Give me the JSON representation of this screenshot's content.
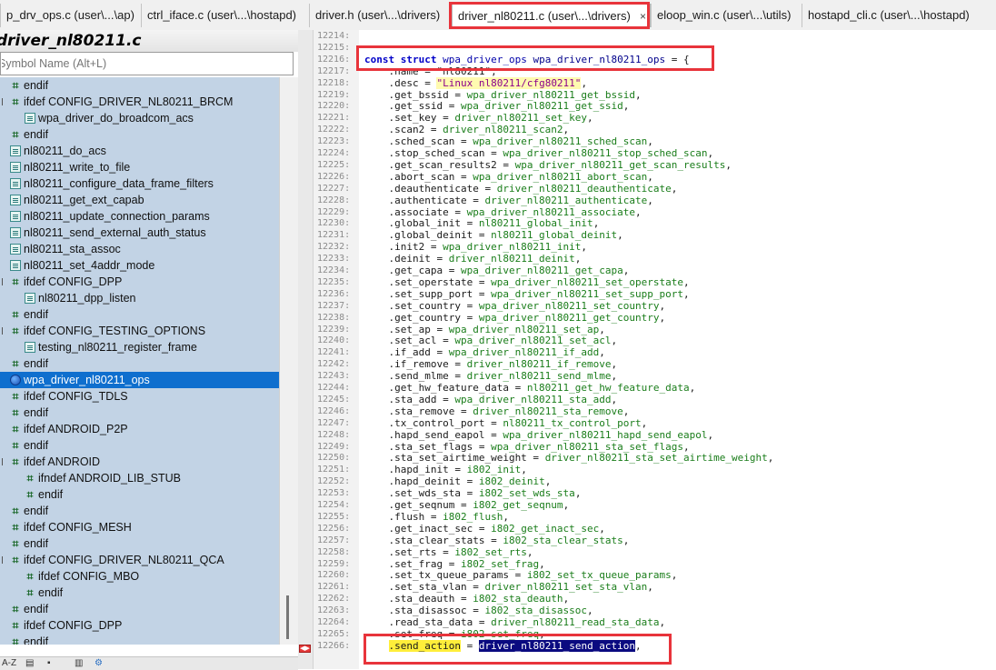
{
  "tabs": [
    {
      "label": "p_drv_ops.c (user\\...\\ap)",
      "active": false
    },
    {
      "label": "ctrl_iface.c (user\\...\\hostapd)",
      "active": false
    },
    {
      "label": "driver.h (user\\...\\drivers)",
      "active": false
    },
    {
      "label": "driver_nl80211.c (user\\...\\drivers)",
      "active": true,
      "close": "×"
    },
    {
      "label": "eloop_win.c (user\\...\\utils)",
      "active": false
    },
    {
      "label": "hostapd_cli.c (user\\...\\hostapd)",
      "active": false
    }
  ],
  "symbol_panel": {
    "file_title": "driver_nl80211.c",
    "search_placeholder": "Symbol Name (Alt+L)",
    "items": [
      {
        "label": "endif",
        "kind": "preproc",
        "indent": 0
      },
      {
        "label": "ifdef CONFIG_DRIVER_NL80211_BRCM",
        "kind": "preproc",
        "indent": 0,
        "collapsible": true
      },
      {
        "label": "wpa_driver_do_broadcom_acs",
        "kind": "function",
        "indent": 1
      },
      {
        "label": "endif",
        "kind": "preproc",
        "indent": 0
      },
      {
        "label": "nl80211_do_acs",
        "kind": "function",
        "indent": 0
      },
      {
        "label": "nl80211_write_to_file",
        "kind": "function",
        "indent": 0
      },
      {
        "label": "nl80211_configure_data_frame_filters",
        "kind": "function",
        "indent": 0
      },
      {
        "label": "nl80211_get_ext_capab",
        "kind": "function",
        "indent": 0
      },
      {
        "label": "nl80211_update_connection_params",
        "kind": "function",
        "indent": 0
      },
      {
        "label": "nl80211_send_external_auth_status",
        "kind": "function",
        "indent": 0
      },
      {
        "label": "nl80211_sta_assoc",
        "kind": "function",
        "indent": 0
      },
      {
        "label": "nl80211_set_4addr_mode",
        "kind": "function",
        "indent": 0
      },
      {
        "label": "ifdef CONFIG_DPP",
        "kind": "preproc",
        "indent": 0,
        "collapsible": true
      },
      {
        "label": "nl80211_dpp_listen",
        "kind": "function",
        "indent": 1
      },
      {
        "label": "endif",
        "kind": "preproc",
        "indent": 0
      },
      {
        "label": "ifdef CONFIG_TESTING_OPTIONS",
        "kind": "preproc",
        "indent": 0,
        "collapsible": true
      },
      {
        "label": "testing_nl80211_register_frame",
        "kind": "function",
        "indent": 1
      },
      {
        "label": "endif",
        "kind": "preproc",
        "indent": 0
      },
      {
        "label": "wpa_driver_nl80211_ops",
        "kind": "variable",
        "indent": 0,
        "selected": true
      },
      {
        "label": "ifdef CONFIG_TDLS",
        "kind": "preproc",
        "indent": 0
      },
      {
        "label": "endif",
        "kind": "preproc",
        "indent": 0
      },
      {
        "label": "ifdef ANDROID_P2P",
        "kind": "preproc",
        "indent": 0
      },
      {
        "label": "endif",
        "kind": "preproc",
        "indent": 0
      },
      {
        "label": "ifdef ANDROID",
        "kind": "preproc",
        "indent": 0,
        "collapsible": true
      },
      {
        "label": "ifndef ANDROID_LIB_STUB",
        "kind": "preproc",
        "indent": 1
      },
      {
        "label": "endif",
        "kind": "preproc",
        "indent": 1
      },
      {
        "label": "endif",
        "kind": "preproc",
        "indent": 0
      },
      {
        "label": "ifdef CONFIG_MESH",
        "kind": "preproc",
        "indent": 0
      },
      {
        "label": "endif",
        "kind": "preproc",
        "indent": 0
      },
      {
        "label": "ifdef CONFIG_DRIVER_NL80211_QCA",
        "kind": "preproc",
        "indent": 0,
        "collapsible": true
      },
      {
        "label": "ifdef CONFIG_MBO",
        "kind": "preproc",
        "indent": 1
      },
      {
        "label": "endif",
        "kind": "preproc",
        "indent": 1
      },
      {
        "label": "endif",
        "kind": "preproc",
        "indent": 0
      },
      {
        "label": "ifdef CONFIG_DPP",
        "kind": "preproc",
        "indent": 0
      },
      {
        "label": "endif",
        "kind": "preproc",
        "indent": 0
      },
      {
        "label": "endif",
        "kind": "preproc",
        "indent": 0
      }
    ],
    "bottom_toolbar": {
      "sort_label": "A-Z"
    }
  },
  "code": {
    "lines": [
      {
        "no": "12214:",
        "segs": []
      },
      {
        "no": "12215:",
        "segs": []
      },
      {
        "no": "12216:",
        "segs": [
          [
            "const",
            "k"
          ],
          [
            " ",
            ""
          ],
          [
            "struct",
            "k"
          ],
          [
            " ",
            ""
          ],
          [
            "wpa_driver_ops",
            "t"
          ],
          [
            " ",
            ""
          ],
          [
            "wpa_driver_nl80211_ops",
            "fnid"
          ],
          [
            " = {",
            ""
          ]
        ]
      },
      {
        "no": "12217:",
        "segs": [
          [
            "    .name = \"nl80211\",",
            ""
          ]
        ]
      },
      {
        "no": "12218:",
        "segs": [
          [
            "    .desc = ",
            ""
          ],
          [
            "\"Linux nl80211/cfg80211\"",
            "str"
          ],
          [
            ",",
            ""
          ]
        ]
      },
      {
        "no": "12219:",
        "segs": [
          [
            "    .get_bssid = ",
            ""
          ],
          [
            "wpa_driver_nl80211_get_bssid",
            "ptr"
          ],
          [
            ",",
            ""
          ]
        ]
      },
      {
        "no": "12220:",
        "segs": [
          [
            "    .get_ssid = ",
            ""
          ],
          [
            "wpa_driver_nl80211_get_ssid",
            "ptr"
          ],
          [
            ",",
            ""
          ]
        ]
      },
      {
        "no": "12221:",
        "segs": [
          [
            "    .set_key = ",
            ""
          ],
          [
            "driver_nl80211_set_key",
            "ptr"
          ],
          [
            ",",
            ""
          ]
        ]
      },
      {
        "no": "12222:",
        "segs": [
          [
            "    .scan2 = ",
            ""
          ],
          [
            "driver_nl80211_scan2",
            "ptr"
          ],
          [
            ",",
            ""
          ]
        ]
      },
      {
        "no": "12223:",
        "segs": [
          [
            "    .sched_scan = ",
            ""
          ],
          [
            "wpa_driver_nl80211_sched_scan",
            "ptr"
          ],
          [
            ",",
            ""
          ]
        ]
      },
      {
        "no": "12224:",
        "segs": [
          [
            "    .stop_sched_scan = ",
            ""
          ],
          [
            "wpa_driver_nl80211_stop_sched_scan",
            "ptr"
          ],
          [
            ",",
            ""
          ]
        ]
      },
      {
        "no": "12225:",
        "segs": [
          [
            "    .get_scan_results2 = ",
            ""
          ],
          [
            "wpa_driver_nl80211_get_scan_results",
            "ptr"
          ],
          [
            ",",
            ""
          ]
        ]
      },
      {
        "no": "12226:",
        "segs": [
          [
            "    .abort_scan = ",
            ""
          ],
          [
            "wpa_driver_nl80211_abort_scan",
            "ptr"
          ],
          [
            ",",
            ""
          ]
        ]
      },
      {
        "no": "12227:",
        "segs": [
          [
            "    .deauthenticate = ",
            ""
          ],
          [
            "driver_nl80211_deauthenticate",
            "ptr"
          ],
          [
            ",",
            ""
          ]
        ]
      },
      {
        "no": "12228:",
        "segs": [
          [
            "    .authenticate = ",
            ""
          ],
          [
            "driver_nl80211_authenticate",
            "ptr"
          ],
          [
            ",",
            ""
          ]
        ]
      },
      {
        "no": "12229:",
        "segs": [
          [
            "    .associate = ",
            ""
          ],
          [
            "wpa_driver_nl80211_associate",
            "ptr"
          ],
          [
            ",",
            ""
          ]
        ]
      },
      {
        "no": "12230:",
        "segs": [
          [
            "    .global_init = ",
            ""
          ],
          [
            "nl80211_global_init",
            "ptr"
          ],
          [
            ",",
            ""
          ]
        ]
      },
      {
        "no": "12231:",
        "segs": [
          [
            "    .global_deinit = ",
            ""
          ],
          [
            "nl80211_global_deinit",
            "ptr"
          ],
          [
            ",",
            ""
          ]
        ]
      },
      {
        "no": "12232:",
        "segs": [
          [
            "    .init2 = ",
            ""
          ],
          [
            "wpa_driver_nl80211_init",
            "ptr"
          ],
          [
            ",",
            ""
          ]
        ]
      },
      {
        "no": "12233:",
        "segs": [
          [
            "    .deinit = ",
            ""
          ],
          [
            "driver_nl80211_deinit",
            "ptr"
          ],
          [
            ",",
            ""
          ]
        ]
      },
      {
        "no": "12234:",
        "segs": [
          [
            "    .get_capa = ",
            ""
          ],
          [
            "wpa_driver_nl80211_get_capa",
            "ptr"
          ],
          [
            ",",
            ""
          ]
        ]
      },
      {
        "no": "12235:",
        "segs": [
          [
            "    .set_operstate = ",
            ""
          ],
          [
            "wpa_driver_nl80211_set_operstate",
            "ptr"
          ],
          [
            ",",
            ""
          ]
        ]
      },
      {
        "no": "12236:",
        "segs": [
          [
            "    .set_supp_port = ",
            ""
          ],
          [
            "wpa_driver_nl80211_set_supp_port",
            "ptr"
          ],
          [
            ",",
            ""
          ]
        ]
      },
      {
        "no": "12237:",
        "segs": [
          [
            "    .set_country = ",
            ""
          ],
          [
            "wpa_driver_nl80211_set_country",
            "ptr"
          ],
          [
            ",",
            ""
          ]
        ]
      },
      {
        "no": "12238:",
        "segs": [
          [
            "    .get_country = ",
            ""
          ],
          [
            "wpa_driver_nl80211_get_country",
            "ptr"
          ],
          [
            ",",
            ""
          ]
        ]
      },
      {
        "no": "12239:",
        "segs": [
          [
            "    .set_ap = ",
            ""
          ],
          [
            "wpa_driver_nl80211_set_ap",
            "ptr"
          ],
          [
            ",",
            ""
          ]
        ]
      },
      {
        "no": "12240:",
        "segs": [
          [
            "    .set_acl = ",
            ""
          ],
          [
            "wpa_driver_nl80211_set_acl",
            "ptr"
          ],
          [
            ",",
            ""
          ]
        ]
      },
      {
        "no": "12241:",
        "segs": [
          [
            "    .if_add = ",
            ""
          ],
          [
            "wpa_driver_nl80211_if_add",
            "ptr"
          ],
          [
            ",",
            ""
          ]
        ]
      },
      {
        "no": "12242:",
        "segs": [
          [
            "    .if_remove = ",
            ""
          ],
          [
            "driver_nl80211_if_remove",
            "ptr"
          ],
          [
            ",",
            ""
          ]
        ]
      },
      {
        "no": "12243:",
        "segs": [
          [
            "    .send_mlme = ",
            ""
          ],
          [
            "driver_nl80211_send_mlme",
            "ptr"
          ],
          [
            ",",
            ""
          ]
        ]
      },
      {
        "no": "12244:",
        "segs": [
          [
            "    .get_hw_feature_data = ",
            ""
          ],
          [
            "nl80211_get_hw_feature_data",
            "ptr"
          ],
          [
            ",",
            ""
          ]
        ]
      },
      {
        "no": "12245:",
        "segs": [
          [
            "    .sta_add = ",
            ""
          ],
          [
            "wpa_driver_nl80211_sta_add",
            "ptr"
          ],
          [
            ",",
            ""
          ]
        ]
      },
      {
        "no": "12246:",
        "segs": [
          [
            "    .sta_remove = ",
            ""
          ],
          [
            "driver_nl80211_sta_remove",
            "ptr"
          ],
          [
            ",",
            ""
          ]
        ]
      },
      {
        "no": "12247:",
        "segs": [
          [
            "    .tx_control_port = ",
            ""
          ],
          [
            "nl80211_tx_control_port",
            "ptr"
          ],
          [
            ",",
            ""
          ]
        ]
      },
      {
        "no": "12248:",
        "segs": [
          [
            "    .hapd_send_eapol = ",
            ""
          ],
          [
            "wpa_driver_nl80211_hapd_send_eapol",
            "ptr"
          ],
          [
            ",",
            ""
          ]
        ]
      },
      {
        "no": "12249:",
        "segs": [
          [
            "    .sta_set_flags = ",
            ""
          ],
          [
            "wpa_driver_nl80211_sta_set_flags",
            "ptr"
          ],
          [
            ",",
            ""
          ]
        ]
      },
      {
        "no": "12250:",
        "segs": [
          [
            "    .sta_set_airtime_weight = ",
            ""
          ],
          [
            "driver_nl80211_sta_set_airtime_weight",
            "ptr"
          ],
          [
            ",",
            ""
          ]
        ]
      },
      {
        "no": "12251:",
        "segs": [
          [
            "    .hapd_init = ",
            ""
          ],
          [
            "i802_init",
            "ptr"
          ],
          [
            ",",
            ""
          ]
        ]
      },
      {
        "no": "12252:",
        "segs": [
          [
            "    .hapd_deinit = ",
            ""
          ],
          [
            "i802_deinit",
            "ptr"
          ],
          [
            ",",
            ""
          ]
        ]
      },
      {
        "no": "12253:",
        "segs": [
          [
            "    .set_wds_sta = ",
            ""
          ],
          [
            "i802_set_wds_sta",
            "ptr"
          ],
          [
            ",",
            ""
          ]
        ]
      },
      {
        "no": "12254:",
        "segs": [
          [
            "    .get_seqnum = ",
            ""
          ],
          [
            "i802_get_seqnum",
            "ptr"
          ],
          [
            ",",
            ""
          ]
        ]
      },
      {
        "no": "12255:",
        "segs": [
          [
            "    .flush = ",
            ""
          ],
          [
            "i802_flush",
            "ptr"
          ],
          [
            ",",
            ""
          ]
        ]
      },
      {
        "no": "12256:",
        "segs": [
          [
            "    .get_inact_sec = ",
            ""
          ],
          [
            "i802_get_inact_sec",
            "ptr"
          ],
          [
            ",",
            ""
          ]
        ]
      },
      {
        "no": "12257:",
        "segs": [
          [
            "    .sta_clear_stats = ",
            ""
          ],
          [
            "i802_sta_clear_stats",
            "ptr"
          ],
          [
            ",",
            ""
          ]
        ]
      },
      {
        "no": "12258:",
        "segs": [
          [
            "    .set_rts = ",
            ""
          ],
          [
            "i802_set_rts",
            "ptr"
          ],
          [
            ",",
            ""
          ]
        ]
      },
      {
        "no": "12259:",
        "segs": [
          [
            "    .set_frag = ",
            ""
          ],
          [
            "i802_set_frag",
            "ptr"
          ],
          [
            ",",
            ""
          ]
        ]
      },
      {
        "no": "12260:",
        "segs": [
          [
            "    .set_tx_queue_params = ",
            ""
          ],
          [
            "i802_set_tx_queue_params",
            "ptr"
          ],
          [
            ",",
            ""
          ]
        ]
      },
      {
        "no": "12261:",
        "segs": [
          [
            "    .set_sta_vlan = ",
            ""
          ],
          [
            "driver_nl80211_set_sta_vlan",
            "ptr"
          ],
          [
            ",",
            ""
          ]
        ]
      },
      {
        "no": "12262:",
        "segs": [
          [
            "    .sta_deauth = ",
            ""
          ],
          [
            "i802_sta_deauth",
            "ptr"
          ],
          [
            ",",
            ""
          ]
        ]
      },
      {
        "no": "12263:",
        "segs": [
          [
            "    .sta_disassoc = ",
            ""
          ],
          [
            "i802_sta_disassoc",
            "ptr"
          ],
          [
            ",",
            ""
          ]
        ]
      },
      {
        "no": "12264:",
        "segs": [
          [
            "    .read_sta_data = ",
            ""
          ],
          [
            "driver_nl80211_read_sta_data",
            "ptr"
          ],
          [
            ",",
            ""
          ]
        ]
      },
      {
        "no": "12265:",
        "segs": [
          [
            "    .set_freq = ",
            ""
          ],
          [
            "i802_set_freq",
            "ptr"
          ],
          [
            ",",
            ""
          ]
        ]
      },
      {
        "no": "12266:",
        "segs": [
          [
            "    ",
            ""
          ],
          [
            ".send_action",
            "hl"
          ],
          [
            " = ",
            ""
          ],
          [
            "driver_nl80211_send_action",
            "hlsel"
          ],
          [
            ",",
            ""
          ]
        ]
      }
    ]
  },
  "colors": {
    "accent_red": "#e8343b",
    "selection_blue": "#0f6fce",
    "tree_background": "#c2d3e5",
    "pointer_green": "#1a7d1a"
  }
}
